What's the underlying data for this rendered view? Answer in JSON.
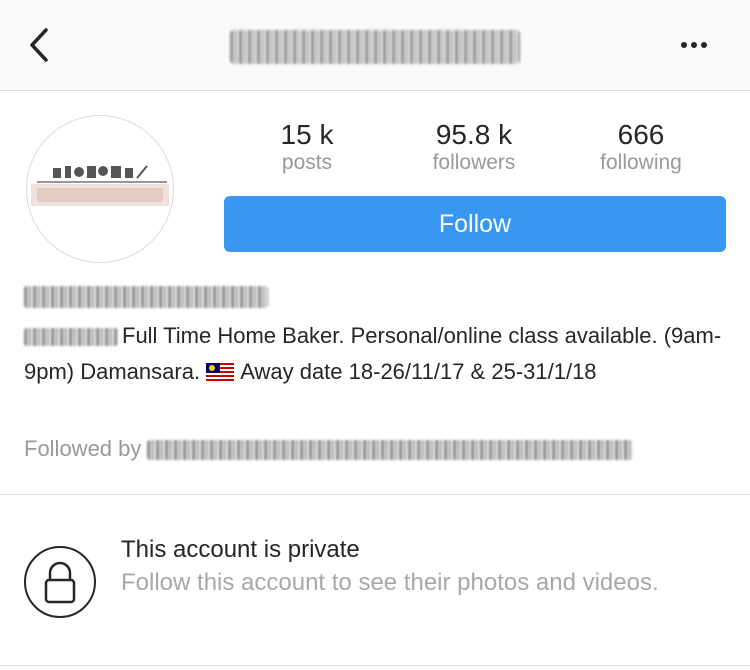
{
  "header": {
    "back_icon": "chevron-left-icon",
    "more_icon": "more-horizontal-icon"
  },
  "profile": {
    "stats": [
      {
        "value": "15 k",
        "label": "posts"
      },
      {
        "value": "95.8 k",
        "label": "followers"
      },
      {
        "value": "666",
        "label": "following"
      }
    ],
    "follow_label": "Follow",
    "follow_color": "#3897f0",
    "bio_text_1": "Full Time Home Baker. Personal/online class available. (9am-9pm) Damansara.",
    "bio_text_2": "Away date 18-26/11/17 & 25-31/1/18",
    "followed_by_label": "Followed by"
  },
  "private_notice": {
    "title": "This account is private",
    "subtitle": "Follow this account to see their photos and videos.",
    "icon": "lock-icon"
  }
}
